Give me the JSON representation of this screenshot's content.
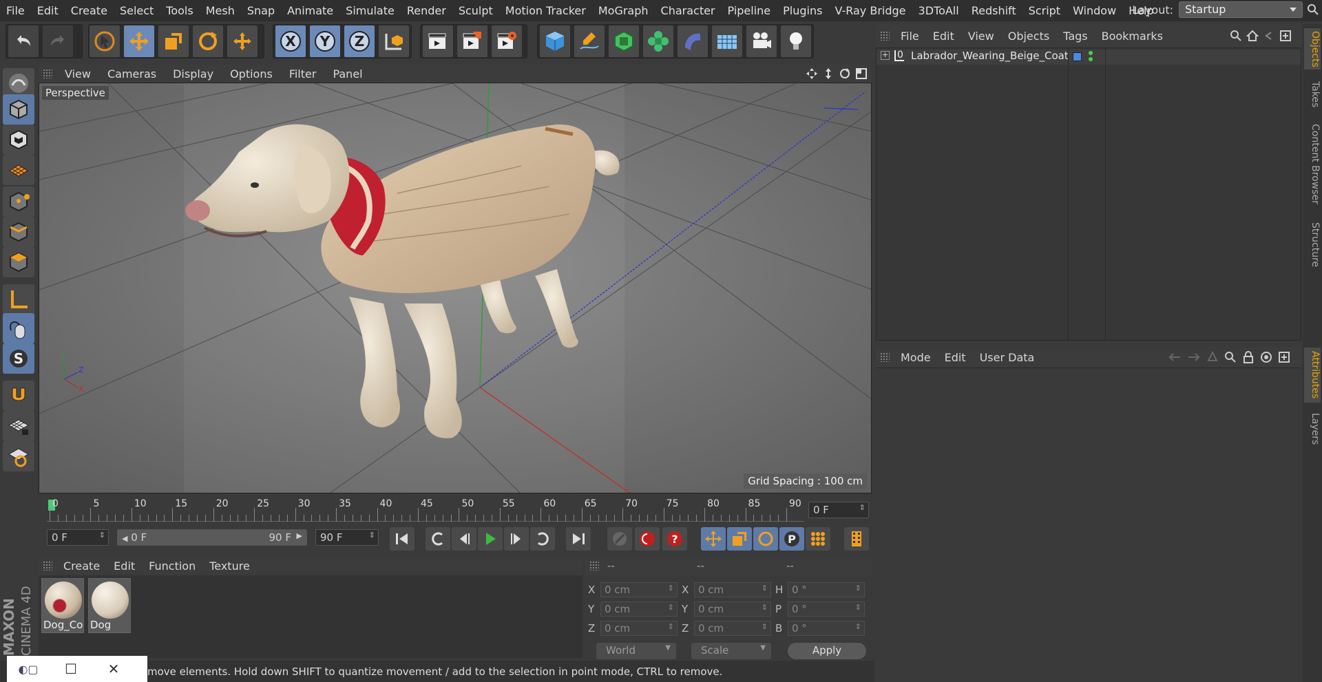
{
  "menu": [
    "File",
    "Edit",
    "Create",
    "Select",
    "Tools",
    "Mesh",
    "Snap",
    "Animate",
    "Simulate",
    "Render",
    "Sculpt",
    "Motion Tracker",
    "MoGraph",
    "Character",
    "Pipeline",
    "Plugins",
    "V-Ray Bridge",
    "3DToAll",
    "Redshift",
    "Script",
    "Window",
    "Help"
  ],
  "layout": {
    "label": "Layout:",
    "value": "Startup"
  },
  "viewport": {
    "menu": [
      "View",
      "Cameras",
      "Display",
      "Options",
      "Filter",
      "Panel"
    ],
    "camera_label": "Perspective",
    "grid_spacing": "Grid Spacing : 100 cm",
    "axis": {
      "y": "Y",
      "z": "Z",
      "x": "X"
    }
  },
  "timeline": {
    "ticks": [
      "0",
      "5",
      "10",
      "15",
      "20",
      "25",
      "30",
      "35",
      "40",
      "45",
      "50",
      "55",
      "60",
      "65",
      "70",
      "75",
      "80",
      "85",
      "90"
    ],
    "current_frame": "0 F",
    "start": "0 F",
    "range_start": "0 F",
    "range_end": "90 F",
    "end": "90 F"
  },
  "materials": {
    "menu": [
      "Create",
      "Edit",
      "Function",
      "Texture"
    ],
    "items": [
      {
        "name": "Dog_Co"
      },
      {
        "name": "Dog"
      }
    ]
  },
  "coords": {
    "headers": [
      "--",
      "--",
      "--"
    ],
    "rows": [
      {
        "a": "X",
        "av": "0 cm",
        "b": "X",
        "bv": "0 cm",
        "c": "H",
        "cv": "0 °"
      },
      {
        "a": "Y",
        "av": "0 cm",
        "b": "Y",
        "bv": "0 cm",
        "c": "P",
        "cv": "0 °"
      },
      {
        "a": "Z",
        "av": "0 cm",
        "b": "Z",
        "bv": "0 cm",
        "c": "B",
        "cv": "0 °"
      }
    ],
    "space": "World",
    "mode": "Scale",
    "apply": "Apply"
  },
  "status": "move elements. Hold down SHIFT to quantize movement / add to the selection in point mode, CTRL to remove.",
  "objects": {
    "menu": [
      "File",
      "Edit",
      "View",
      "Objects",
      "Tags",
      "Bookmarks"
    ],
    "items": [
      {
        "name": "Labrador_Wearing_Beige_Coat"
      }
    ]
  },
  "attributes": {
    "menu": [
      "Mode",
      "Edit",
      "User Data"
    ]
  },
  "side_tabs": [
    "Objects",
    "Takes",
    "Content Browser",
    "Structure",
    "Attributes",
    "Layers"
  ],
  "logo": {
    "line1": "MAXON",
    "line2": "CINEMA 4D"
  },
  "colors": {
    "accent": "#6c8ab8",
    "highlight": "#e6a400",
    "play": "#3dbb3d"
  }
}
